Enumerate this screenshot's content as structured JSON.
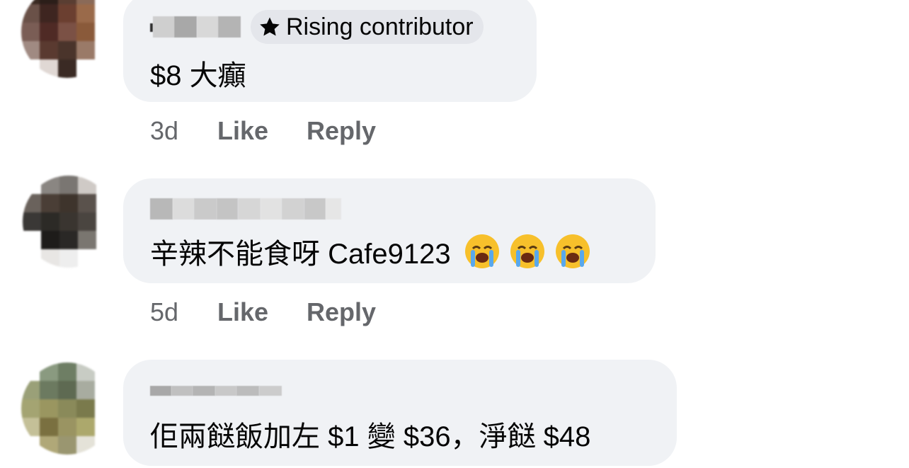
{
  "comments": [
    {
      "badge_label": "Rising contributor",
      "badge_icon": "star-icon",
      "text": "$8 大癲",
      "time": "3d",
      "like_label": "Like",
      "reply_label": "Reply",
      "emojis": []
    },
    {
      "text": "辛辣不能食呀 Cafe9123",
      "time": "5d",
      "like_label": "Like",
      "reply_label": "Reply",
      "emojis": [
        "loudly-crying-face-icon",
        "loudly-crying-face-icon",
        "loudly-crying-face-icon"
      ]
    },
    {
      "text": "佢兩餸飯加左 $1 變 $36，淨餸 $48"
    }
  ],
  "colors": {
    "bubble_bg": "#f0f2f5",
    "badge_bg": "#e4e6eb",
    "meta_text": "#65676b",
    "primary_text": "#050505"
  }
}
